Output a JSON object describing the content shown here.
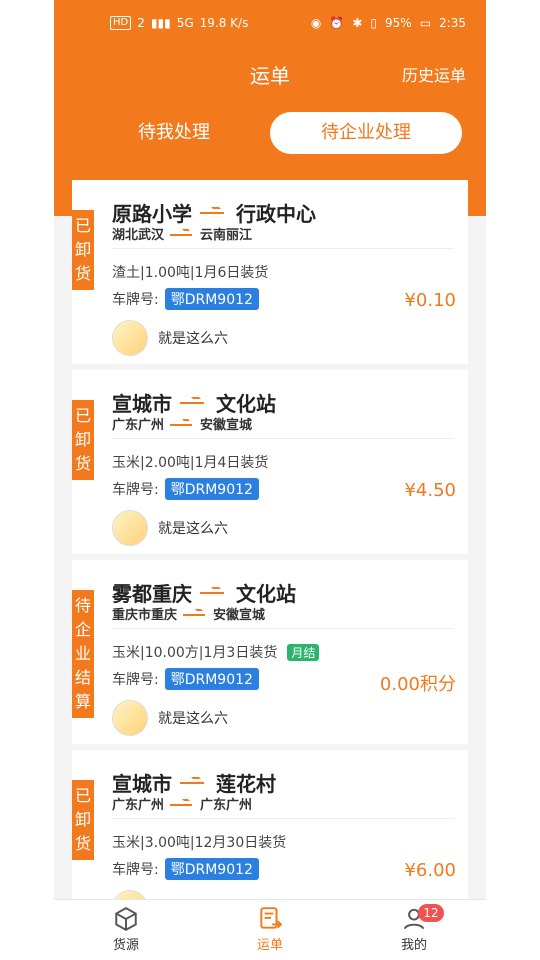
{
  "status_bar": {
    "left": [
      "HD",
      "2",
      "5G",
      "19.8 K/s"
    ],
    "battery": "95%",
    "time": "2:35"
  },
  "header": {
    "title": "运单",
    "history": "历史运单"
  },
  "tabs": [
    "待我处理",
    "待企业处理"
  ],
  "orders": [
    {
      "status": "已卸货",
      "from": "原路小学",
      "to": "行政中心",
      "from_region": "湖北武汉",
      "to_region": "云南丽江",
      "info": "渣土|1.00吨|1月6日装货",
      "plate_label": "车牌号:",
      "plate": "鄂DRM9012",
      "price": "¥0.10",
      "owner": "就是这么六"
    },
    {
      "status": "已卸货",
      "from": "宣城市",
      "to": "文化站",
      "from_region": "广东广州",
      "to_region": "安徽宣城",
      "info": "玉米|2.00吨|1月4日装货",
      "plate_label": "车牌号:",
      "plate": "鄂DRM9012",
      "price": "¥4.50",
      "owner": "就是这么六"
    },
    {
      "status": "待企业结算",
      "from": "雾都重庆",
      "to": "文化站",
      "from_region": "重庆市重庆",
      "to_region": "安徽宣城",
      "info": "玉米|10.00方|1月3日装货",
      "badge": "月结",
      "plate_label": "车牌号:",
      "plate": "鄂DRM9012",
      "price": "0.00积分",
      "owner": "就是这么六"
    },
    {
      "status": "已卸货",
      "from": "宣城市",
      "to": "莲花村",
      "from_region": "广东广州",
      "to_region": "广东广州",
      "info": "玉米|3.00吨|12月30日装货",
      "plate_label": "车牌号:",
      "plate": "鄂DRM9012",
      "price": "¥6.00",
      "owner": ""
    }
  ],
  "bottom_nav": [
    {
      "label": "货源"
    },
    {
      "label": "运单"
    },
    {
      "label": "我的",
      "badge": "12"
    }
  ],
  "colors": {
    "accent": "#f27a1d",
    "plate": "#2a7fe0",
    "badge": "#2db36b",
    "notify": "#f05151"
  }
}
